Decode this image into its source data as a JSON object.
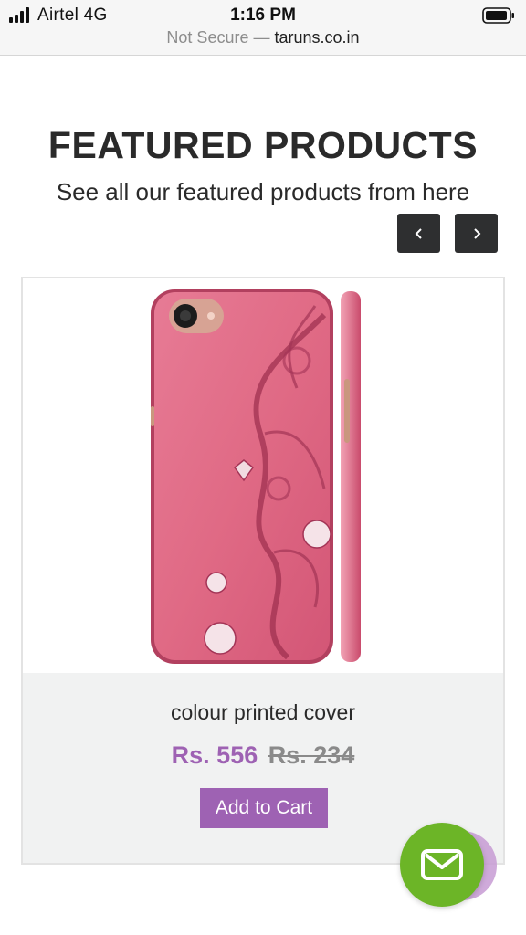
{
  "status_bar": {
    "carrier": "Airtel 4G",
    "time": "1:16 PM",
    "security_label": "Not Secure",
    "separator": "—",
    "host": "taruns.co.in",
    "icons": [
      "signal-bars-icon",
      "battery-icon"
    ]
  },
  "section": {
    "title": "FEATURED PRODUCTS",
    "subtitle": "See all our featured products from here",
    "prev_icon": "chevron-left-icon",
    "next_icon": "chevron-right-icon"
  },
  "product": {
    "name": "colour printed cover",
    "price_current": "Rs. 556",
    "price_old": "Rs. 234",
    "add_to_cart_label": "Add to Cart",
    "image_desc": "pink phone case with floral pattern"
  },
  "chat": {
    "icon": "mail-icon"
  },
  "colors": {
    "accent_purple": "#9e62b3",
    "chat_green": "#6cb527",
    "nav_button": "#2e2f30",
    "case_pink": "#e06a85"
  }
}
